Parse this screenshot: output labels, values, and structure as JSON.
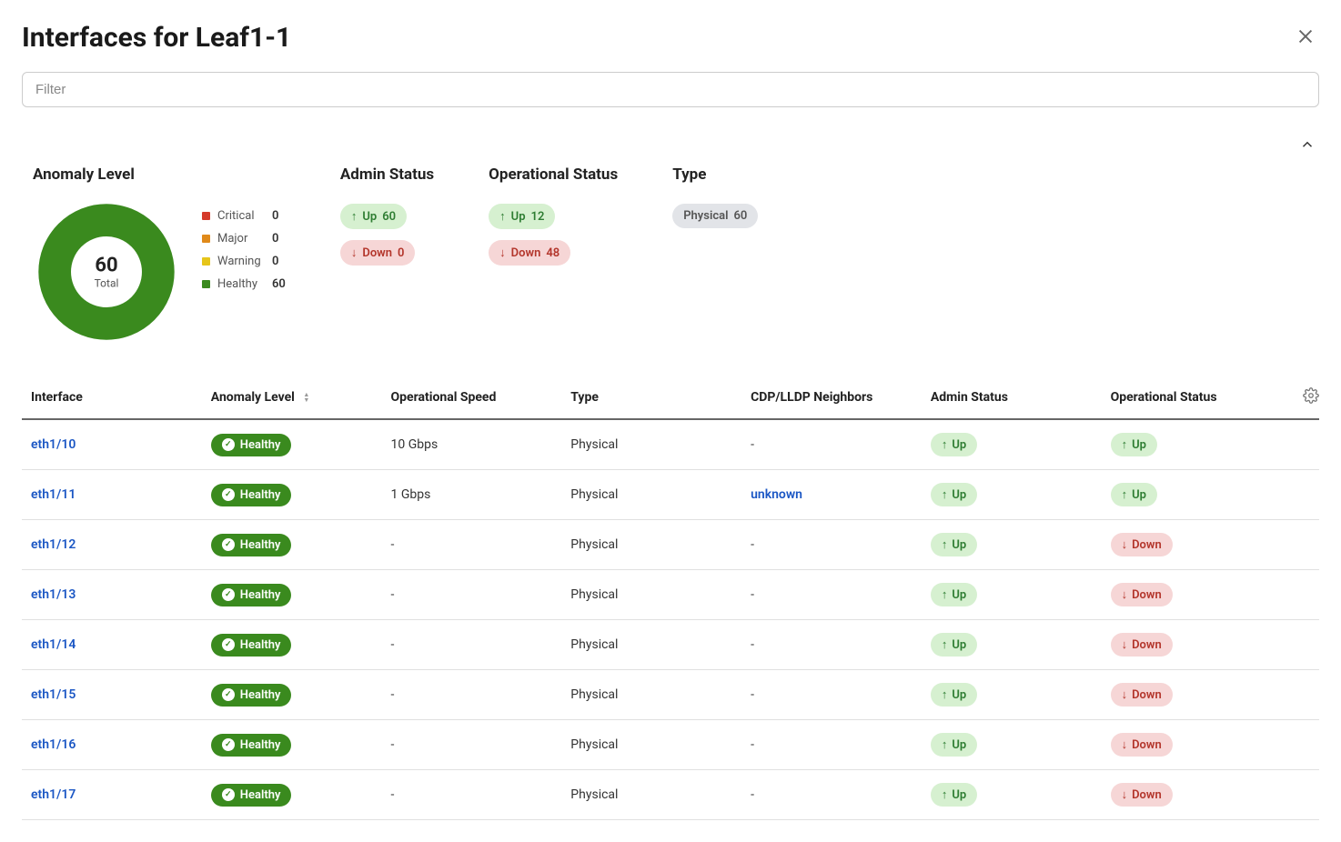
{
  "title": "Interfaces for Leaf1-1",
  "filter": {
    "placeholder": "Filter"
  },
  "chart_data": {
    "type": "pie",
    "title": "Anomaly Level",
    "total_label": "Total",
    "total": 60,
    "series": [
      {
        "name": "Critical",
        "value": 0,
        "color": "#d53a2a"
      },
      {
        "name": "Major",
        "value": 0,
        "color": "#e08a1a"
      },
      {
        "name": "Warning",
        "value": 0,
        "color": "#e6c51a"
      },
      {
        "name": "Healthy",
        "value": 60,
        "color": "#3a8a1e"
      }
    ]
  },
  "summary": {
    "admin_status": {
      "heading": "Admin Status",
      "up": {
        "label": "Up",
        "value": 60
      },
      "down": {
        "label": "Down",
        "value": 0
      }
    },
    "operational_status": {
      "heading": "Operational Status",
      "up": {
        "label": "Up",
        "value": 12
      },
      "down": {
        "label": "Down",
        "value": 48
      }
    },
    "type": {
      "heading": "Type",
      "chip": {
        "label": "Physical",
        "value": 60
      }
    }
  },
  "table": {
    "headers": {
      "interface": "Interface",
      "anomaly": "Anomaly Level",
      "speed": "Operational Speed",
      "type": "Type",
      "neighbors": "CDP/LLDP Neighbors",
      "admin": "Admin Status",
      "oper": "Operational Status"
    },
    "rows": [
      {
        "interface": "eth1/10",
        "anomaly": "Healthy",
        "speed": "10 Gbps",
        "type": "Physical",
        "neighbors": "-",
        "admin": "Up",
        "oper": "Up"
      },
      {
        "interface": "eth1/11",
        "anomaly": "Healthy",
        "speed": "1 Gbps",
        "type": "Physical",
        "neighbors": "unknown",
        "admin": "Up",
        "oper": "Up"
      },
      {
        "interface": "eth1/12",
        "anomaly": "Healthy",
        "speed": "-",
        "type": "Physical",
        "neighbors": "-",
        "admin": "Up",
        "oper": "Down"
      },
      {
        "interface": "eth1/13",
        "anomaly": "Healthy",
        "speed": "-",
        "type": "Physical",
        "neighbors": "-",
        "admin": "Up",
        "oper": "Down"
      },
      {
        "interface": "eth1/14",
        "anomaly": "Healthy",
        "speed": "-",
        "type": "Physical",
        "neighbors": "-",
        "admin": "Up",
        "oper": "Down"
      },
      {
        "interface": "eth1/15",
        "anomaly": "Healthy",
        "speed": "-",
        "type": "Physical",
        "neighbors": "-",
        "admin": "Up",
        "oper": "Down"
      },
      {
        "interface": "eth1/16",
        "anomaly": "Healthy",
        "speed": "-",
        "type": "Physical",
        "neighbors": "-",
        "admin": "Up",
        "oper": "Down"
      },
      {
        "interface": "eth1/17",
        "anomaly": "Healthy",
        "speed": "-",
        "type": "Physical",
        "neighbors": "-",
        "admin": "Up",
        "oper": "Down"
      }
    ]
  }
}
